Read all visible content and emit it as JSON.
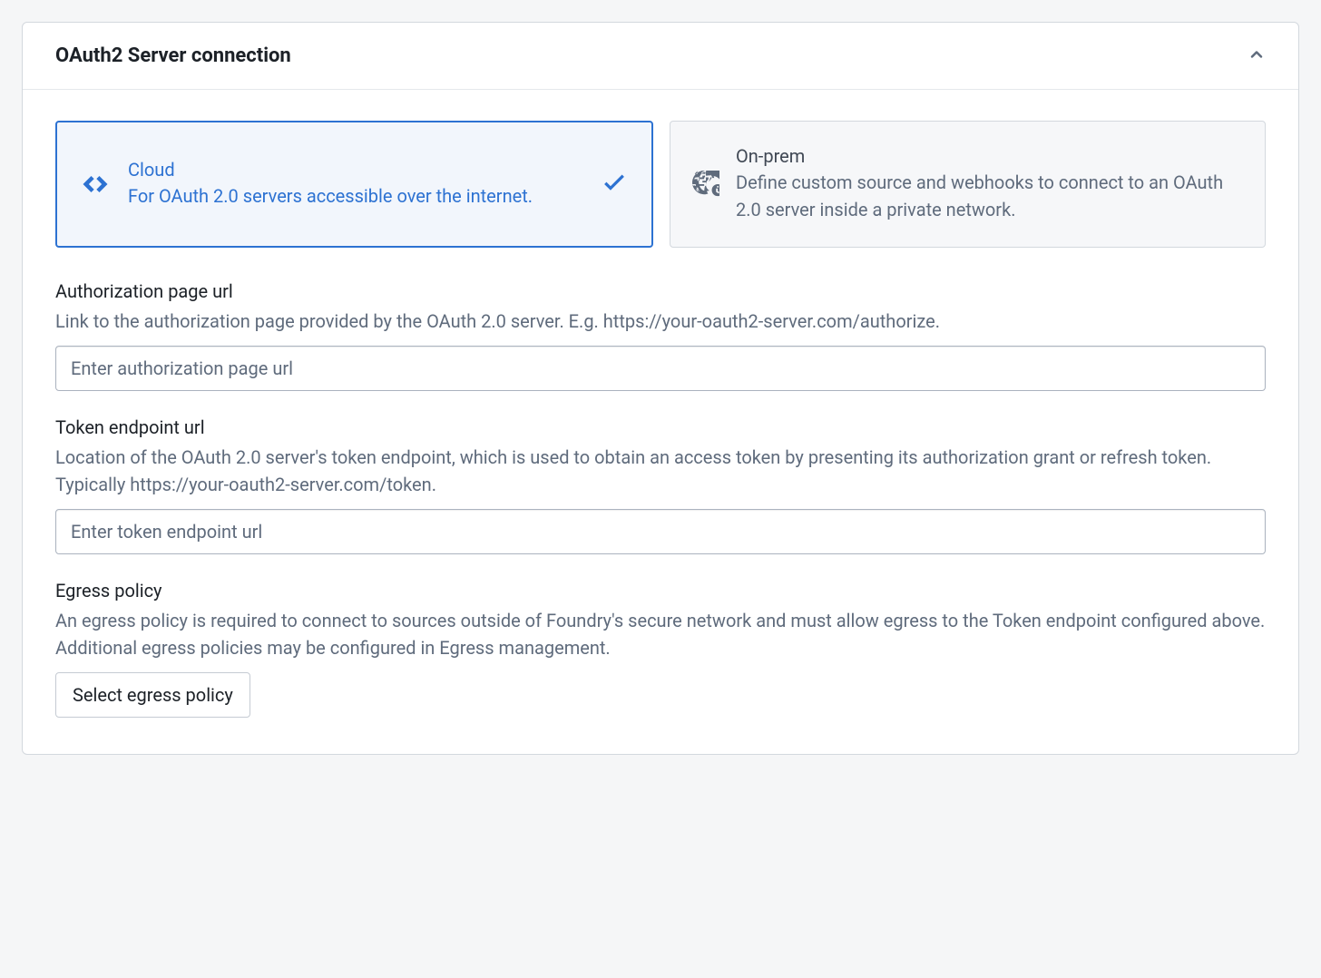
{
  "panel": {
    "title": "OAuth2 Server connection"
  },
  "options": {
    "cloud": {
      "title": "Cloud",
      "description": "For OAuth 2.0 servers accessible over the internet."
    },
    "onprem": {
      "title": "On-prem",
      "description": "Define custom source and webhooks to connect to an OAuth 2.0 server inside a private network."
    }
  },
  "fields": {
    "authUrl": {
      "label": "Authorization page url",
      "help": "Link to the authorization page provided by the OAuth 2.0 server. E.g. https://your-oauth2-server.com/authorize.",
      "placeholder": "Enter authorization page url",
      "value": ""
    },
    "tokenUrl": {
      "label": "Token endpoint url",
      "help": "Location of the OAuth 2.0 server's token endpoint, which is used to obtain an access token by presenting its authorization grant or refresh token. Typically https://your-oauth2-server.com/token.",
      "placeholder": "Enter token endpoint url",
      "value": ""
    },
    "egress": {
      "label": "Egress policy",
      "help": "An egress policy is required to connect to sources outside of Foundry's secure network and must allow egress to the Token endpoint configured above. Additional egress policies may be configured in Egress management.",
      "buttonLabel": "Select egress policy"
    }
  }
}
